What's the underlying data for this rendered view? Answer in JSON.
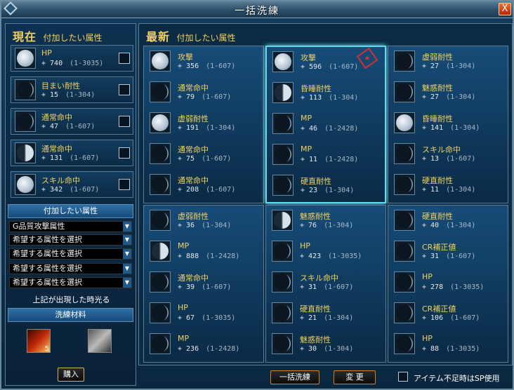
{
  "window": {
    "title": "一括洗練",
    "close_label": "X"
  },
  "current": {
    "heading": "現在",
    "subheading": "付加したい属性",
    "slots": [
      {
        "name": "HP",
        "value": "+ 740",
        "range": "(1-3035)",
        "moon": "full"
      },
      {
        "name": "目まい耐性",
        "value": "+ 15",
        "range": "(1-304)",
        "moon": "dark"
      },
      {
        "name": "通常命中",
        "value": "+ 47",
        "range": "(1-607)",
        "moon": "dark"
      },
      {
        "name": "通常命中",
        "value": "+ 131",
        "range": "(1-607)",
        "moon": "half"
      },
      {
        "name": "スキル命中",
        "value": "+ 342",
        "range": "(1-607)",
        "moon": "full"
      }
    ]
  },
  "attr_section": {
    "header": "付加したい属性",
    "dropdowns": [
      "G品質攻撃属性",
      "希望する属性を選択",
      "希望する属性を選択",
      "希望する属性を選択",
      "希望する属性を選択"
    ],
    "notice": "上記が出現した時光る"
  },
  "materials": {
    "header": "洗練材料",
    "count1": "5",
    "buy_label": "購入"
  },
  "newest": {
    "heading": "最新",
    "subheading": "付加したい属性",
    "panels": [
      {
        "slots": [
          {
            "name": "攻撃",
            "value": "+ 356",
            "range": "(1-607)",
            "moon": "full"
          },
          {
            "name": "通常命中",
            "value": "+ 79",
            "range": "(1-607)",
            "moon": "dark"
          },
          {
            "name": "虚弱耐性",
            "value": "+ 191",
            "range": "(1-304)",
            "moon": "full"
          },
          {
            "name": "通常命中",
            "value": "+ 75",
            "range": "(1-607)",
            "moon": "dark"
          },
          {
            "name": "通常命中",
            "value": "+ 208",
            "range": "(1-607)",
            "moon": "dark"
          }
        ]
      },
      {
        "slots": [
          {
            "name": "攻撃",
            "value": "+ 596",
            "range": "(1-607)",
            "moon": "full"
          },
          {
            "name": "昏睡耐性",
            "value": "+ 113",
            "range": "(1-304)",
            "moon": "half"
          },
          {
            "name": "MP",
            "value": "+ 46",
            "range": "(1-2428)",
            "moon": "dark"
          },
          {
            "name": "MP",
            "value": "+ 11",
            "range": "(1-2428)",
            "moon": "dark"
          },
          {
            "name": "硬直耐性",
            "value": "+ 23",
            "range": "(1-304)",
            "moon": "dark"
          }
        ]
      },
      {
        "slots": [
          {
            "name": "虚弱耐性",
            "value": "+ 27",
            "range": "(1-304)",
            "moon": "dark"
          },
          {
            "name": "魅惑耐性",
            "value": "+ 27",
            "range": "(1-304)",
            "moon": "dark"
          },
          {
            "name": "昏睡耐性",
            "value": "+ 141",
            "range": "(1-304)",
            "moon": "full"
          },
          {
            "name": "スキル命中",
            "value": "+ 13",
            "range": "(1-607)",
            "moon": "dark"
          },
          {
            "name": "硬直耐性",
            "value": "+ 11",
            "range": "(1-304)",
            "moon": "dark"
          }
        ]
      },
      {
        "slots": [
          {
            "name": "虚弱耐性",
            "value": "+ 36",
            "range": "(1-304)",
            "moon": "dark"
          },
          {
            "name": "MP",
            "value": "+ 888",
            "range": "(1-2428)",
            "moon": "half"
          },
          {
            "name": "通常命中",
            "value": "+ 39",
            "range": "(1-607)",
            "moon": "dark"
          },
          {
            "name": "HP",
            "value": "+ 67",
            "range": "(1-3035)",
            "moon": "dark"
          },
          {
            "name": "MP",
            "value": "+ 236",
            "range": "(1-2428)",
            "moon": "dark"
          }
        ]
      },
      {
        "slots": [
          {
            "name": "魅惑耐性",
            "value": "+ 76",
            "range": "(1-304)",
            "moon": "half"
          },
          {
            "name": "HP",
            "value": "+ 423",
            "range": "(1-3035)",
            "moon": "dark"
          },
          {
            "name": "スキル命中",
            "value": "+ 31",
            "range": "(1-607)",
            "moon": "dark"
          },
          {
            "name": "硬直耐性",
            "value": "+ 21",
            "range": "(1-304)",
            "moon": "dark"
          },
          {
            "name": "魅惑耐性",
            "value": "+ 30",
            "range": "(1-304)",
            "moon": "dark"
          }
        ]
      },
      {
        "slots": [
          {
            "name": "硬直耐性",
            "value": "+ 40",
            "range": "(1-304)",
            "moon": "dark"
          },
          {
            "name": "CR補正値",
            "value": "+ 31",
            "range": "(1-607)",
            "moon": "dark"
          },
          {
            "name": "HP",
            "value": "+ 278",
            "range": "(1-3035)",
            "moon": "dark"
          },
          {
            "name": "CR補正値",
            "value": "+ 106",
            "range": "(1-607)",
            "moon": "dark"
          },
          {
            "name": "HP",
            "value": "+ 88",
            "range": "(1-3035)",
            "moon": "dark"
          }
        ]
      }
    ]
  },
  "footer": {
    "refine_all_label": "一括洗練",
    "change_label": "変 更",
    "sp_label": "アイテム不足時はSP使用"
  }
}
